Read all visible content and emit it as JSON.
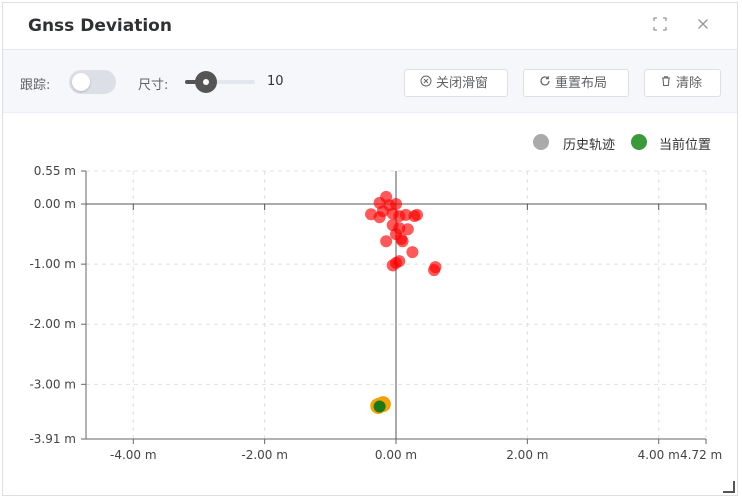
{
  "window": {
    "title": "Gnss Deviation"
  },
  "titlebar": {
    "fullscreen_icon": "fullscreen-icon",
    "close_icon": "close-icon"
  },
  "toolbar": {
    "track_label": "跟踪:",
    "track_on": false,
    "size_label": "尺寸:",
    "size_value": "10",
    "size_fraction": 0.3,
    "buttons": [
      {
        "label": "关闭滑窗",
        "icon": "close-circle-icon"
      },
      {
        "label": "重置布局",
        "icon": "refresh-icon"
      },
      {
        "label": "清除",
        "icon": "trash-icon"
      }
    ]
  },
  "legend": [
    {
      "label": "历史轨迹",
      "color": "#aaaaaa"
    },
    {
      "label": "当前位置",
      "color": "#3a9a3a"
    }
  ],
  "chart_data": {
    "type": "scatter",
    "xlim": [
      -4.72,
      4.72
    ],
    "ylim": [
      -3.91,
      0.55
    ],
    "x_ticks": [
      "-4.00 m",
      "-2.00 m",
      "0.00 m",
      "2.00 m",
      "4.00 m",
      "4.72 m"
    ],
    "x_tick_values": [
      -4,
      -2,
      0,
      2,
      4,
      4.72
    ],
    "y_ticks": [
      "0.55 m",
      "0.00 m",
      "-1.00 m",
      "-2.00 m",
      "-3.00 m",
      "-3.91 m"
    ],
    "y_tick_values": [
      0.55,
      0,
      -1,
      -2,
      -3,
      -3.91
    ],
    "grid": true,
    "legend_position": "top-right",
    "series": [
      {
        "name": "历史轨迹",
        "color": "#ff0000",
        "points": [
          [
            -0.15,
            0.12
          ],
          [
            -0.25,
            0.02
          ],
          [
            -0.1,
            -0.02
          ],
          [
            0.0,
            0.0
          ],
          [
            -0.2,
            -0.12
          ],
          [
            -0.38,
            -0.17
          ],
          [
            -0.25,
            -0.22
          ],
          [
            -0.05,
            -0.16
          ],
          [
            0.05,
            -0.2
          ],
          [
            0.15,
            -0.18
          ],
          [
            0.28,
            -0.2
          ],
          [
            0.32,
            -0.18
          ],
          [
            -0.05,
            -0.35
          ],
          [
            0.05,
            -0.4
          ],
          [
            0.18,
            -0.42
          ],
          [
            0.0,
            -0.5
          ],
          [
            0.08,
            -0.58
          ],
          [
            0.1,
            -0.62
          ],
          [
            -0.15,
            -0.62
          ],
          [
            0.25,
            -0.8
          ],
          [
            0.05,
            -0.95
          ],
          [
            0.0,
            -0.98
          ],
          [
            -0.05,
            -1.02
          ],
          [
            0.6,
            -1.05
          ],
          [
            0.58,
            -1.1
          ]
        ]
      },
      {
        "name": "current-overlay",
        "color": "#f5a200",
        "points": [
          [
            -0.2,
            -3.33
          ],
          [
            -0.27,
            -3.36
          ]
        ]
      },
      {
        "name": "当前位置",
        "color": "#1a7a1a",
        "points": [
          [
            -0.25,
            -3.37
          ]
        ]
      }
    ]
  }
}
